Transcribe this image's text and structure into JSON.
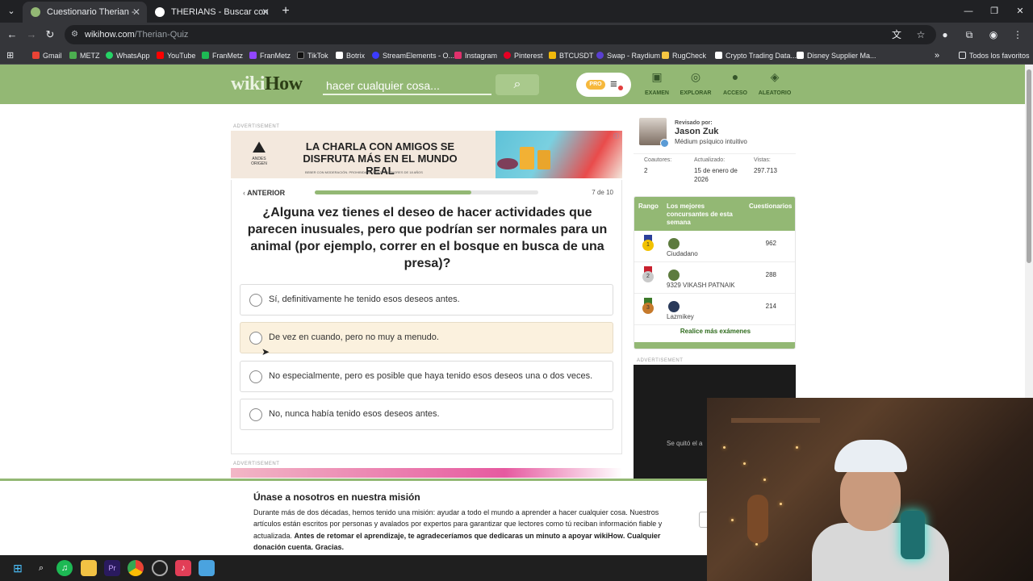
{
  "browser": {
    "tabs": [
      {
        "title": "Cuestionario Therian - wikiHow",
        "active": true
      },
      {
        "title": "THERIANS - Buscar con Google",
        "active": false
      }
    ],
    "new_tab": "+",
    "url_host": "wikihow.com",
    "url_path": "/Therian-Quiz"
  },
  "bookmarks": [
    {
      "label": "Gmail",
      "color": "#ea4335"
    },
    {
      "label": "METZ",
      "color": "#4caf50"
    },
    {
      "label": "WhatsApp",
      "color": "#25d366"
    },
    {
      "label": "YouTube",
      "color": "#ff0000"
    },
    {
      "label": "FranMetz",
      "color": "#1db954"
    },
    {
      "label": "FranMetz",
      "color": "#9146ff"
    },
    {
      "label": "TikTok",
      "color": "#111111"
    },
    {
      "label": "Botrix",
      "color": "#ffffff"
    },
    {
      "label": "StreamElements - O...",
      "color": "#3b3bff"
    },
    {
      "label": "Instagram",
      "color": "#e1306c"
    },
    {
      "label": "Pinterest",
      "color": "#e60023"
    },
    {
      "label": "BTCUSDT",
      "color": "#f0b90b"
    },
    {
      "label": "Swap - Raydium",
      "color": "#5a3fd1"
    },
    {
      "label": "RugCheck",
      "color": "#f5c542"
    },
    {
      "label": "Crypto Trading Data...",
      "color": "#ffffff"
    },
    {
      "label": "Disney Supplier Ma...",
      "color": "#ffffff"
    }
  ],
  "bookmarks_all": "Todos los favoritos",
  "wikihow": {
    "logo_light": "wiki",
    "logo_dark": "How",
    "search_placeholder": "hacer cualquier cosa...",
    "pro_badge": "PRO",
    "nav": [
      {
        "label": "EXAMEN",
        "icon": "quiz-icon"
      },
      {
        "label": "EXPLORAR",
        "icon": "compass-icon"
      },
      {
        "label": "ACCESO",
        "icon": "user-icon"
      },
      {
        "label": "ALEATORIO",
        "icon": "dice-icon"
      }
    ]
  },
  "ad": {
    "label": "ADVERTISEMENT",
    "brand_line1": "ANDES",
    "brand_line2": "ORIGEN",
    "headline": "LA CHARLA CON AMIGOS SE DISFRUTA MÁS EN EL MUNDO REAL",
    "fineprint": "BEBER CON MODERACIÓN. PROHIBIDA SU VENTA A MENORES DE 18 AÑOS"
  },
  "quiz": {
    "prev": "ANTERIOR",
    "progress": 0.7,
    "count": "7 de 10",
    "question": "¿Alguna vez tienes el deseo de hacer actividades que parecen inusuales, pero que podrían ser normales para un animal (por ejemplo, correr en el bosque en busca de una presa)?",
    "options": [
      "Sí, definitivamente he tenido esos deseos antes.",
      "De vez en cuando, pero no muy a menudo.",
      "No especialmente, pero es posible que haya tenido esos deseos una o dos veces.",
      "No, nunca había tenido esos deseos antes."
    ]
  },
  "sidebar": {
    "reviewed_by": "Revisado por:",
    "reviewer_name": "Jason Zuk",
    "reviewer_title": "Médium psíquico intuitivo",
    "stats": [
      {
        "label": "Coautores:",
        "value": "2"
      },
      {
        "label": "Actualizado:",
        "value": "15 de enero de 2026"
      },
      {
        "label": "Vistas:",
        "value": "297.713"
      }
    ],
    "leaderboard": {
      "col_rank": "Rango",
      "col_name": "Los mejores concursantes de esta semana",
      "col_score": "Cuestionarios",
      "rows": [
        {
          "rank": "1",
          "name": "Ciudadano",
          "score": "962",
          "ribbon": "#2a3f9a",
          "coin": "#f2c200"
        },
        {
          "rank": "2",
          "name": "9329 VIKASH PATNAIK",
          "score": "288",
          "ribbon": "#c8202e",
          "coin": "#c9c9c9"
        },
        {
          "rank": "3",
          "name": "Lazmikey",
          "score": "214",
          "ribbon": "#3c7a2a",
          "coin": "#c67a2c"
        }
      ],
      "more": "Realice más exámenes"
    },
    "dark_ad_text": "Se quitó el a"
  },
  "mission": {
    "title": "Únase a nosotros en nuestra misión",
    "body_plain": "Durante más de dos décadas, hemos tenido una misión: ayudar a todo el mundo a aprender a hacer cualquier cosa. Nuestros artículos están escritos por personas y avalados por expertos para garantizar que lectores como tú reciban información fiable y actualizada. ",
    "body_bold": "Antes de retomar el aprendizaje, te agradeceríamos que dedicaras un minuto a apoyar wikiHow. Cualquier donación cuenta. Gracias."
  }
}
